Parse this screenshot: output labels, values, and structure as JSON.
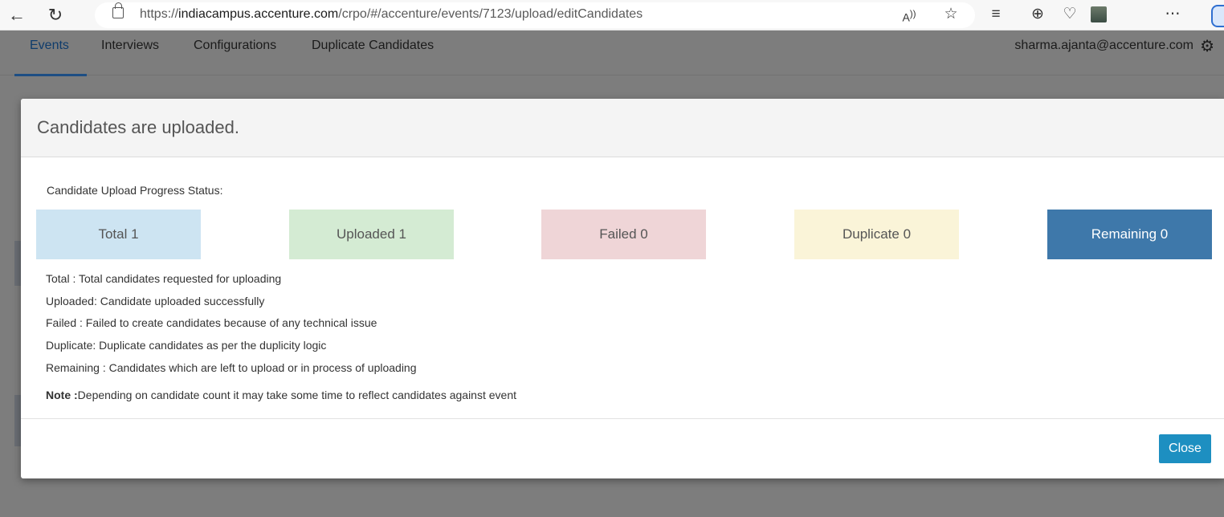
{
  "browser": {
    "url_prefix": "https://",
    "url_host": "indiacampus.accenture.com",
    "url_path": "/crpo/#/accenture/events/7123/upload/editCandidates",
    "read_aloud_label": "A̅"
  },
  "app": {
    "tabs": [
      {
        "label": "Events",
        "active": true
      },
      {
        "label": "Interviews"
      },
      {
        "label": "Configurations"
      },
      {
        "label": "Duplicate Candidates"
      }
    ],
    "user_email": "sharma.ajanta@accenture.com"
  },
  "modal": {
    "title": "Candidates are uploaded.",
    "progress_label": "Candidate Upload Progress Status:",
    "status": [
      {
        "label": "Total 1",
        "color": "#cde4f2"
      },
      {
        "label": "Uploaded 1",
        "color": "#d4ebd3"
      },
      {
        "label": "Failed 0",
        "color": "#efd5d7"
      },
      {
        "label": "Duplicate 0",
        "color": "#faf4d8"
      },
      {
        "label": "Remaining 0",
        "color": "#3e78aa"
      }
    ],
    "legend": [
      "Total : Total candidates requested for uploading",
      "Uploaded: Candidate uploaded successfully",
      "Failed : Failed to create candidates because of any technical issue",
      "Duplicate: Duplicate candidates as per the duplicity logic",
      "Remaining : Candidates which are left to upload or in process of uploading"
    ],
    "note_label": "Note :",
    "note_text": "Depending on candidate count it may take some time to reflect candidates against event",
    "close_label": "Close"
  }
}
